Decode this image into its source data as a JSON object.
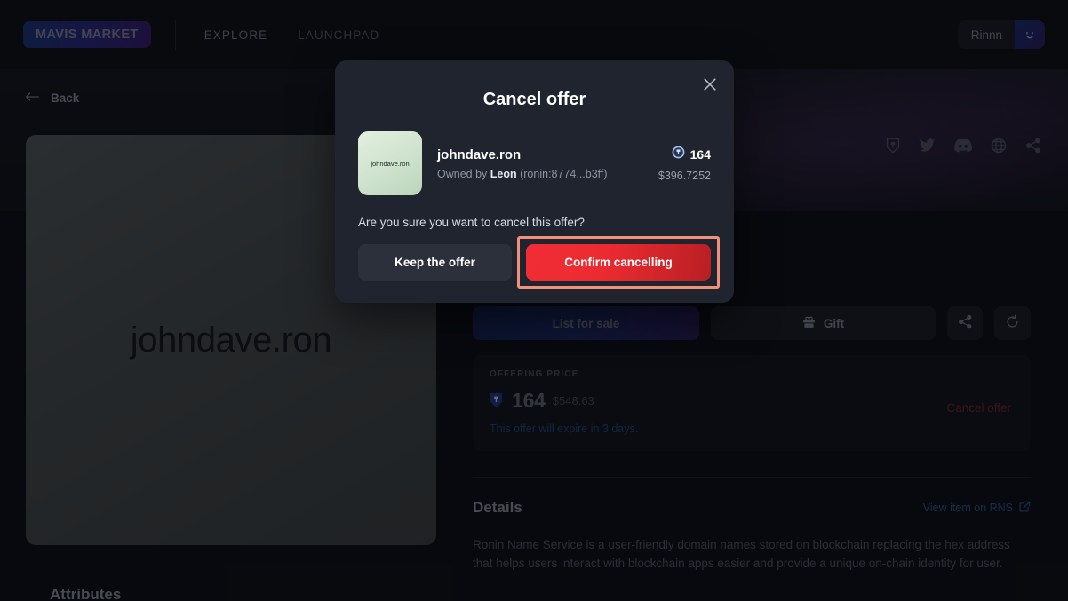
{
  "nav": {
    "brand": "MAVIS MARKET",
    "links": [
      {
        "label": "EXPLORE"
      },
      {
        "label": "LAUNCHPAD"
      }
    ],
    "user": {
      "name": "Rinnn",
      "avatar_icon": "smiley-face-icon"
    }
  },
  "page": {
    "back_label": "Back",
    "back_icon": "arrow-left-icon",
    "social_icons": [
      "ronin-shield-icon",
      "twitter-icon",
      "discord-icon",
      "globe-icon",
      "share-icon"
    ],
    "item_card_name": "johndave.ron",
    "attributes_title": "Attributes"
  },
  "actions": {
    "list_for_sale": "List for sale",
    "gift": "Gift",
    "gift_icon": "gift-icon",
    "share_icon": "share-icon",
    "refresh_icon": "refresh-icon"
  },
  "offer": {
    "label": "OFFERING PRICE",
    "ron_icon": "ron-shield-icon",
    "amount": "164",
    "usd": "$548.63",
    "expiry": "This offer will expire in 3 days.",
    "cancel_link": "Cancel offer"
  },
  "details": {
    "title": "Details",
    "link_label": "View item on RNS",
    "link_icon": "external-link-icon",
    "body": "Ronin Name Service is a user-friendly domain names stored on blockchain replacing the hex address that helps users interact with blockchain apps easier and provide a unique on-chain identity for user."
  },
  "modal": {
    "title": "Cancel offer",
    "close_icon": "close-icon",
    "thumb_text": "johndave.ron",
    "item_name": "johndave.ron",
    "owner_prefix": "Owned by",
    "owner_name": "Leon",
    "owner_address": "(ronin:8774...b3ff)",
    "price_icon": "ron-coin-icon",
    "price_amount": "164",
    "price_usd": "$396.7252",
    "question": "Are you sure you want to cancel this offer?",
    "keep_label": "Keep the offer",
    "confirm_label": "Confirm cancelling"
  },
  "colors": {
    "accent_red": "#ec2b31",
    "focus_ring": "#f1917a",
    "link_blue": "#2b5f97",
    "brand_gradient_start": "#1c3a80",
    "brand_gradient_end": "#3a1f75"
  }
}
